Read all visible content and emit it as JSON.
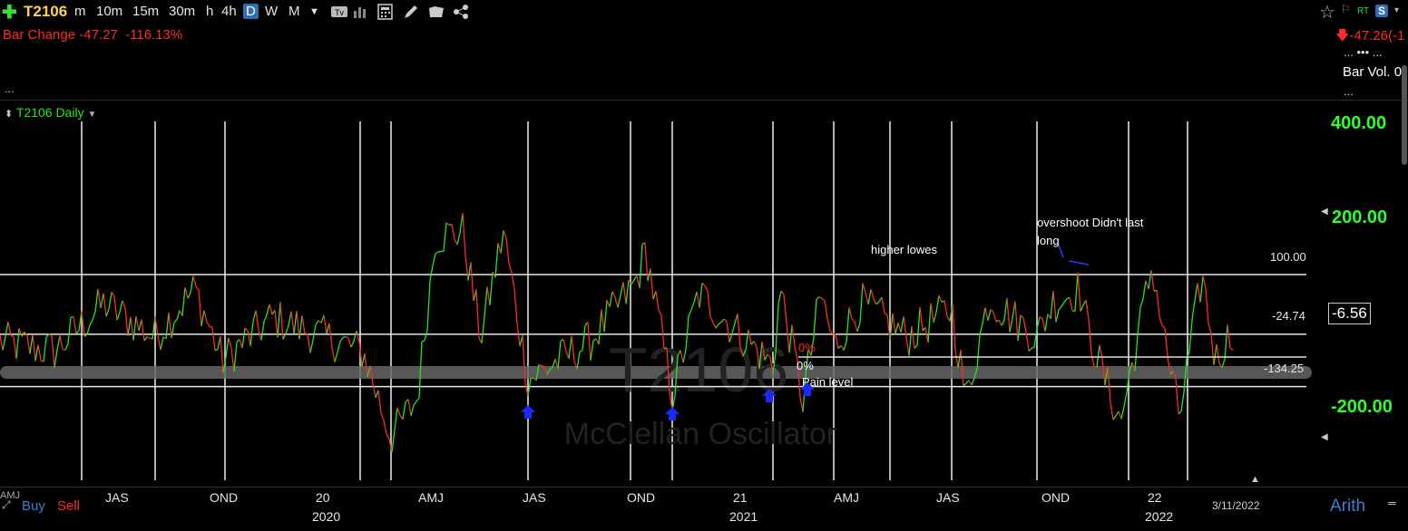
{
  "toolbar": {
    "symbol": "T2106",
    "timeframes": [
      "m",
      "10m",
      "15m",
      "30m",
      "h",
      "4h",
      "D",
      "W",
      "M"
    ],
    "active_timeframe": "D",
    "right_rt": "RT",
    "right_s": "S"
  },
  "header": {
    "bar_change_label": "Bar Change",
    "bar_change_value": "-47.27",
    "bar_change_pct": "-116.13%",
    "dots_left": "...",
    "right_change": "-47.26(-1",
    "right_dots": "... ••• ...",
    "bar_vol_label": "Bar Vol. 0",
    "right_dots2": "..."
  },
  "chart_header": {
    "title": "T2106 Daily"
  },
  "chart_data": {
    "type": "line",
    "watermark_title": "T2106",
    "watermark_subtitle": "McClellan Oscillator",
    "y_ticks": [
      "400.00",
      "200.00",
      "-200.00"
    ],
    "ylim": [
      -330,
      420
    ],
    "current_value": "-6.56",
    "levels": [
      {
        "label": "100.00",
        "value": 100
      },
      {
        "label": "-24.74",
        "value": -24.74
      },
      {
        "label": "-134.25",
        "value": -134.25
      }
    ],
    "x_ticks": [
      "JAS",
      "OND",
      "20",
      "AMJ",
      "JAS",
      "OND",
      "21",
      "AMJ",
      "JAS",
      "OND",
      "22"
    ],
    "x_years": [
      "2020",
      "2021",
      "2022"
    ],
    "date_label": "3/11/2022",
    "scale_label": "Arith",
    "annotations": [
      "higher lowes",
      "overshoot Didn't last long",
      "0%",
      "0%",
      "Pain level"
    ],
    "buy_label": "Buy",
    "sell_label": "Sell",
    "colors": {
      "up": "#23e61e",
      "down": "#ff2a2a",
      "markers": "#1a2aff",
      "ticks": "#2dff2a"
    }
  }
}
